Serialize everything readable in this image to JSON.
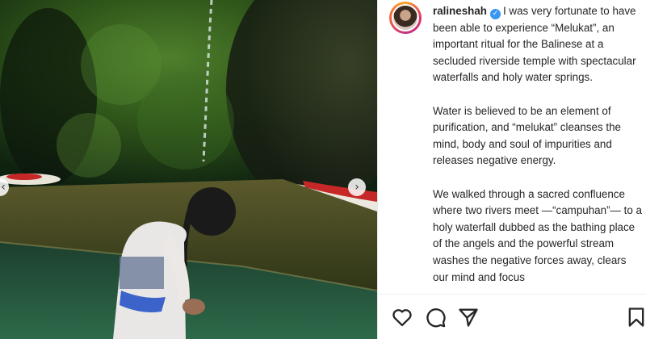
{
  "post": {
    "username": "ralineshah",
    "verified_icon": "verified-badge-icon",
    "caption_first_line": "I was very fortunate to have been able to experience “Melukat”, an important ritual for the Balinese at a secluded riverside temple with spectacular waterfalls and holy water springs.",
    "caption_paragraphs": [
      "Water is believed to be an element of purification, and “melukat” cleanses the mind, body and soul of impurities and releases negative energy.",
      "We walked through a sacred confluence where two rivers meet —“campuhan”— to a holy waterfall dubbed as the bathing place of the angels and the powerful stream washes the negative forces away, clears our mind and focus"
    ]
  },
  "carousel": {
    "next_icon": "chevron-right-icon",
    "prev_icon": "chevron-left-icon"
  },
  "actions": {
    "icons": [
      "heart-icon",
      "comment-icon",
      "share-icon",
      "bookmark-icon"
    ]
  },
  "colors": {
    "text": "#262626",
    "verified": "#3897f0",
    "ring_start": "#f9a825",
    "ring_end": "#c13584"
  }
}
